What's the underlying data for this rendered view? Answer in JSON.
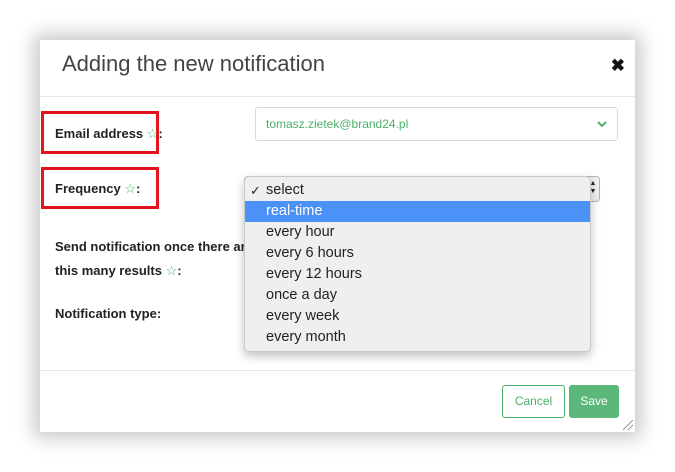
{
  "modal": {
    "title": "Adding the new notification",
    "close_glyph": "✖"
  },
  "form": {
    "email_label": "Email address",
    "email_value": "tomasz.zietek@brand24.pl",
    "frequency_label": "Frequency",
    "results_label_line1": "Send notification once there are",
    "results_label_line2": "this many results",
    "type_label": "Notification type:",
    "colon": ":",
    "star_glyph": "☆"
  },
  "frequency_dropdown": {
    "selected": "select",
    "highlighted": "real-time",
    "options": [
      "select",
      "real-time",
      "every hour",
      "every 6 hours",
      "every 12 hours",
      "once a day",
      "every week",
      "every month"
    ]
  },
  "footer": {
    "cancel_label": "Cancel",
    "save_label": "Save"
  },
  "colors": {
    "accent_green": "#4bb06a",
    "highlight_blue": "#4b91f7",
    "callout_red": "#e3141f"
  }
}
